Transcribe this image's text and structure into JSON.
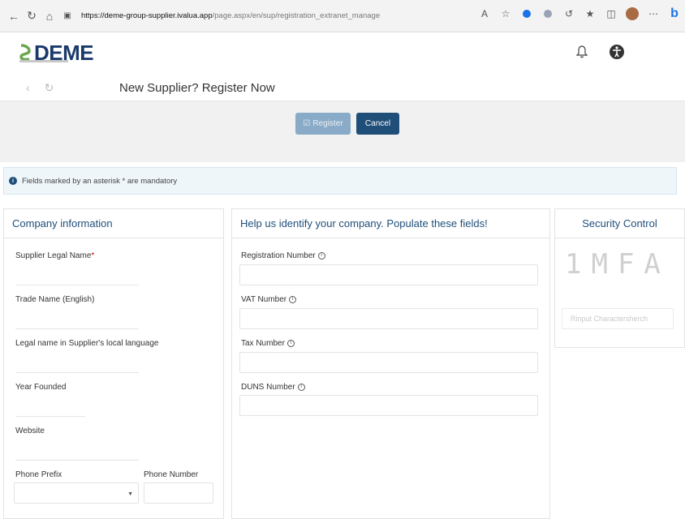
{
  "browser": {
    "url_host": "https://deme-group-supplier.ivalua.app",
    "url_path": "/page.aspx/en/sup/registration_extranet_manage",
    "zoom_icon_text": "A"
  },
  "header": {
    "logo_text": "DEME"
  },
  "titlebar": {
    "title": "New Supplier? Register Now"
  },
  "actions": {
    "register_label": "Register",
    "cancel_label": "Cancel"
  },
  "notice": {
    "text": "Fields marked by an asterisk * are mandatory"
  },
  "company_panel": {
    "heading": "Company information",
    "fields": {
      "legal_name": "Supplier Legal Name",
      "asterisk": "*",
      "trade_name": "Trade Name (English)",
      "local_name": "Legal name in Supplier's local language",
      "year_founded": "Year Founded",
      "website": "Website",
      "phone_prefix": "Phone Prefix",
      "phone_number": "Phone Number"
    }
  },
  "identify_panel": {
    "heading": "Help us identify your company. Populate these fields!",
    "fields": {
      "registration_number": "Registration Number",
      "vat_number": "VAT Number",
      "tax_number": "Tax Number",
      "duns_number": "DUNS Number"
    }
  },
  "security_panel": {
    "heading": "Security Control",
    "captcha_text": "1MFA",
    "captcha_placeholder": "Rinput Charactersherch"
  },
  "colors": {
    "brand": "#1f4e79",
    "register_disabled": "#8aabc7",
    "logo_green": "#6aa84f"
  }
}
